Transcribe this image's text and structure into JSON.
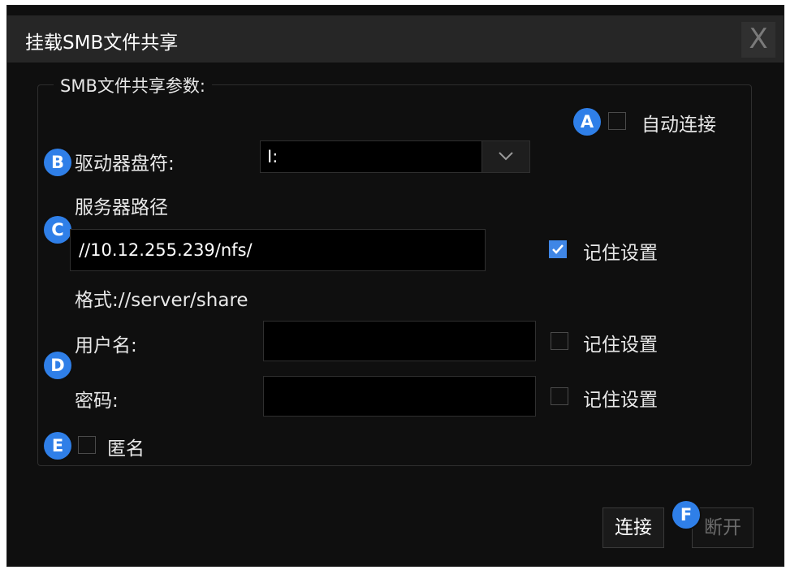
{
  "dialog": {
    "title": "挂载SMB文件共享",
    "close_label": "X"
  },
  "group": {
    "title": "SMB文件共享参数:"
  },
  "auto_connect": {
    "label": "自动连接",
    "checked": false
  },
  "drive": {
    "label": "驱动器盘符:",
    "value": "I:"
  },
  "server": {
    "label": "服务器路径",
    "value": "//10.12.255.239/nfs/",
    "format_hint": "格式://server/share",
    "remember_label": "记住设置",
    "remember_checked": true
  },
  "username": {
    "label": "用户名:",
    "value": "",
    "remember_label": "记住设置",
    "remember_checked": false
  },
  "password": {
    "label": "密码:",
    "value": "",
    "remember_label": "记住设置",
    "remember_checked": false
  },
  "anonymous": {
    "label": "匿名",
    "checked": false
  },
  "buttons": {
    "connect": "连接",
    "disconnect": "断开"
  },
  "badges": {
    "a": "A",
    "b": "B",
    "c": "C",
    "d": "D",
    "e": "E",
    "f": "F"
  },
  "colors": {
    "accent": "#2f7fe8",
    "checked": "#3f86e6",
    "background": "#0f0f0f"
  }
}
